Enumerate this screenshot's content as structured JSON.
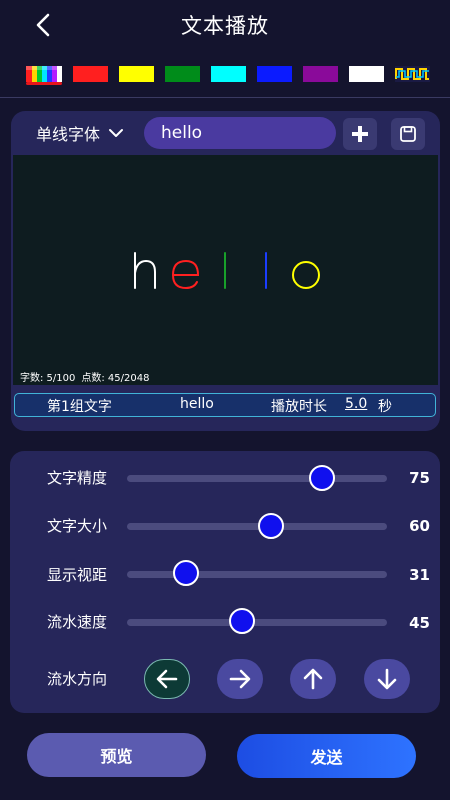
{
  "header": {
    "title": "文本播放"
  },
  "colors": {
    "swatches": [
      "#ff1f1f",
      "#ffff00",
      "#008c1a",
      "#00ffff",
      "#0b1bff",
      "#8a0a9a",
      "#ffffff"
    ],
    "accent": "#1010ee",
    "selected_underline": "#e6161b"
  },
  "editor": {
    "font_name": "单线字体",
    "text_value": "hello",
    "preview_letters": [
      {
        "char": "h",
        "color": "#ffffff"
      },
      {
        "char": "e",
        "color": "#ff2020"
      },
      {
        "char": "l",
        "color": "#18a02a"
      },
      {
        "char": "l",
        "color": "#1b3dff"
      },
      {
        "char": "o",
        "color": "#ffff00"
      }
    ],
    "char_count_label": "字数: 5/100",
    "point_count_label": "点数: 45/2048"
  },
  "group": {
    "label": "第1组文字",
    "text": "hello",
    "duration_label": "播放时长",
    "duration_value": "5.0",
    "duration_unit": "秒"
  },
  "settings": {
    "sliders": [
      {
        "label": "文字精度",
        "value": 75
      },
      {
        "label": "文字大小",
        "value": 60
      },
      {
        "label": "显示视距",
        "value": 31
      },
      {
        "label": "流水速度",
        "value": 45
      }
    ],
    "direction_label": "流水方向",
    "directions": [
      "left",
      "right",
      "up",
      "down"
    ],
    "active_direction": "left"
  },
  "actions": {
    "preview_label": "预览",
    "send_label": "发送"
  }
}
